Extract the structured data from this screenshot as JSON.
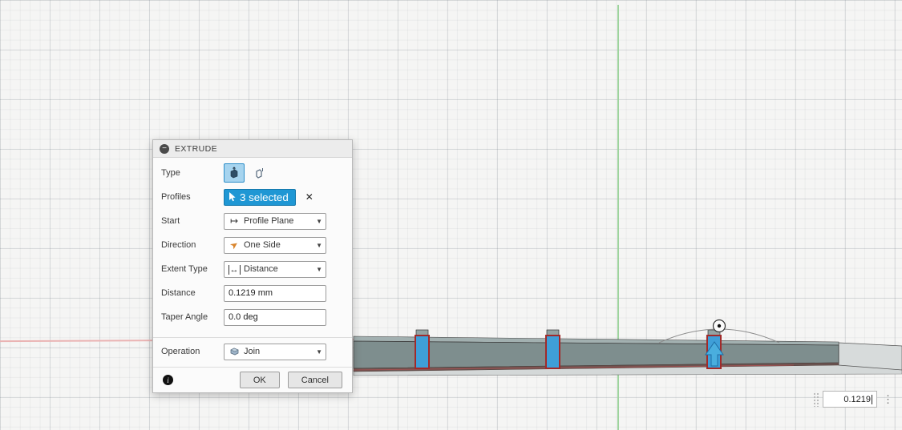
{
  "dialog": {
    "title": "EXTRUDE",
    "rows": {
      "type": {
        "label": "Type"
      },
      "profiles": {
        "label": "Profiles",
        "value": "3 selected"
      },
      "start": {
        "label": "Start",
        "value": "Profile Plane"
      },
      "direction": {
        "label": "Direction",
        "value": "One Side"
      },
      "extent": {
        "label": "Extent Type",
        "value": "Distance"
      },
      "distance": {
        "label": "Distance",
        "value": "0.1219 mm"
      },
      "taper": {
        "label": "Taper Angle",
        "value": "0.0 deg"
      },
      "operation": {
        "label": "Operation",
        "value": "Join"
      }
    },
    "buttons": {
      "ok": "OK",
      "cancel": "Cancel"
    }
  },
  "canvas": {
    "distance_value": "0.1219"
  },
  "colors": {
    "accent_blue": "#1f97d4",
    "selection_blue": "#3aa7e0",
    "axis_green": "#9ed49e",
    "axis_red": "#eab3b3",
    "model_gray_green": "#7e8e8e"
  }
}
